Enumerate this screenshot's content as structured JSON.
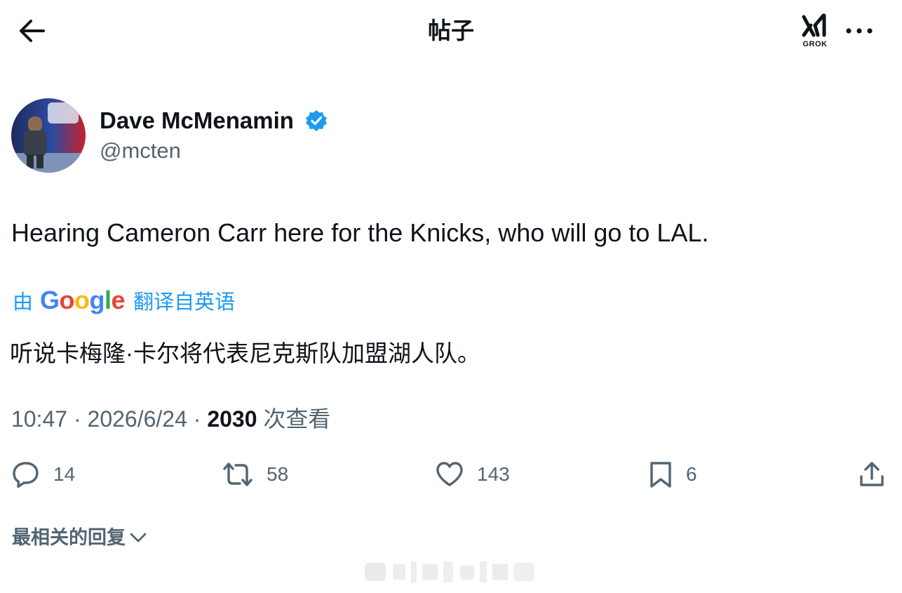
{
  "header": {
    "title": "帖子",
    "back_icon": "arrow-left-icon",
    "grok_label": "GROK",
    "more_icon": "more-horizontal-icon"
  },
  "author": {
    "display_name": "Dave McMenamin",
    "handle": "@mcten",
    "verified": true,
    "verified_color": "#1d9bf0"
  },
  "tweet": {
    "text": "Hearing Cameron Carr here for the Knicks, who will go to LAL.",
    "translate_prefix": "由",
    "translate_provider": "Google",
    "translate_suffix": "翻译自英语",
    "translated_text": "听说卡梅隆·卡尔将代表尼克斯队加盟湖人队。"
  },
  "meta": {
    "time": "10:47",
    "separator": " · ",
    "date": "2026/6/24",
    "views": "2030",
    "views_label": " 次查看"
  },
  "actions": {
    "reply": {
      "icon": "reply-icon",
      "count": "14"
    },
    "retweet": {
      "icon": "retweet-icon",
      "count": "58"
    },
    "like": {
      "icon": "heart-icon",
      "count": "143"
    },
    "bookmark": {
      "icon": "bookmark-icon",
      "count": "6"
    },
    "share": {
      "icon": "share-icon"
    }
  },
  "replies": {
    "sort_label": "最相关的回复"
  },
  "colors": {
    "text_primary": "#0f1419",
    "text_secondary": "#536471",
    "accent": "#1d9bf0"
  }
}
